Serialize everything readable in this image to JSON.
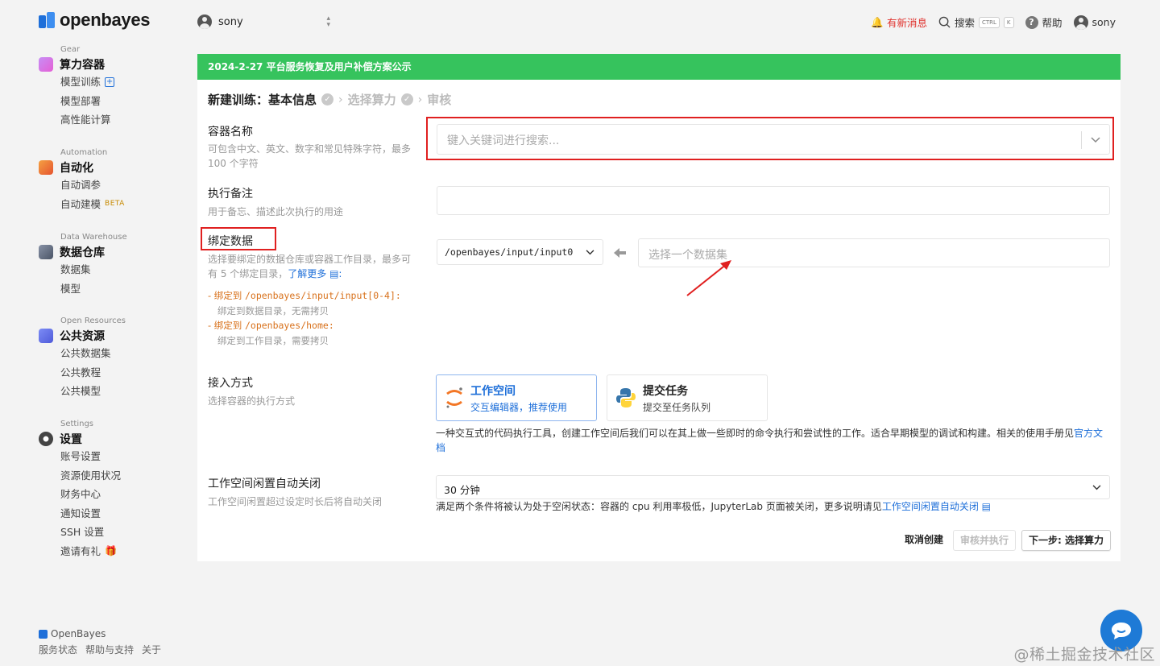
{
  "brand": {
    "name": "openbayes"
  },
  "sidebar": {
    "groups": [
      {
        "caption": "Gear",
        "label": "算力容器",
        "icon": "gear-cube-icon",
        "items": [
          "模型训练",
          "模型部署",
          "高性能计算"
        ]
      },
      {
        "caption": "Automation",
        "label": "自动化",
        "icon": "automation-icon",
        "items": [
          "自动调参",
          "自动建模"
        ],
        "beta": "BETA"
      },
      {
        "caption": "Data Warehouse",
        "label": "数据仓库",
        "icon": "data-warehouse-icon",
        "items": [
          "数据集",
          "模型"
        ]
      },
      {
        "caption": "Open Resources",
        "label": "公共资源",
        "icon": "open-resources-icon",
        "items": [
          "公共数据集",
          "公共教程",
          "公共模型"
        ]
      },
      {
        "caption": "Settings",
        "label": "设置",
        "icon": "settings-gear-icon",
        "items": [
          "账号设置",
          "资源使用状况",
          "财务中心",
          "通知设置",
          "SSH 设置",
          "邀请有礼"
        ]
      }
    ],
    "footer": {
      "brand": "OpenBayes",
      "links": [
        "服务状态",
        "帮助与支持",
        "关于"
      ]
    }
  },
  "topbar": {
    "user_select": "sony",
    "notify": "有新消息",
    "search": "搜索",
    "kbd_ctrl": "CTRL",
    "kbd_k": "K",
    "help": "帮助",
    "user": "sony"
  },
  "banner": "2024-2-27 平台服务恢复及用户补偿方案公示",
  "steps": {
    "current": "新建训练：基本信息",
    "step2": "选择算力",
    "step3": "审核"
  },
  "form": {
    "name": {
      "label": "容器名称",
      "desc": "可包含中文、英文、数字和常见特殊字符，最多 100 个字符",
      "placeholder": "键入关键词进行搜索..."
    },
    "remark": {
      "label": "执行备注",
      "desc": "用于备忘、描述此次执行的用途",
      "value": ""
    },
    "bind": {
      "label": "绑定数据",
      "desc": "选择要绑定的数据仓库或容器工作目录，最多可有 5 个绑定目录，",
      "learn_more": "了解更多",
      "rule1_prefix": "- 绑定到 ",
      "rule1_path": "/openbayes/input/input[0-4]:",
      "rule1_desc": "绑定到数据目录，无需拷贝",
      "rule2_prefix": "- 绑定到 ",
      "rule2_path": "/openbayes/home:",
      "rule2_desc": "绑定到工作目录，需要拷贝",
      "path_select": "/openbayes/input/input0",
      "dataset_placeholder": "选择一个数据集"
    },
    "access": {
      "label": "接入方式",
      "desc": "选择容器的执行方式",
      "options": [
        {
          "title": "工作空间",
          "sub": "交互编辑器，推荐使用",
          "icon": "jupyter-icon"
        },
        {
          "title": "提交任务",
          "sub": "提交至任务队列",
          "icon": "python-icon"
        }
      ],
      "info": "一种交互式的代码执行工具，创建工作空间后我们可以在其上做一些即时的命令执行和尝试性的工作。适合早期模型的调试和构建。相关的使用手册见",
      "info_link": "官方文档"
    },
    "idle": {
      "label": "工作空间闲置自动关闭",
      "desc": "工作空间闲置超过设定时长后将自动关闭",
      "value": "30 分钟",
      "info": "满足两个条件将被认为处于空闲状态：容器的 cpu 利用率极低，JupyterLab 页面被关闭，更多说明请见",
      "info_link": "工作空间闲置自动关闭"
    }
  },
  "actions": {
    "cancel": "取消创建",
    "review": "审核并执行",
    "next": "下一步: 选择算力"
  },
  "watermark": "@稀土掘金技术社区",
  "colors": {
    "accent": "#1e6fd9",
    "banner": "#36c35d",
    "highlight": "#e02020",
    "orange": "#d8711b"
  }
}
